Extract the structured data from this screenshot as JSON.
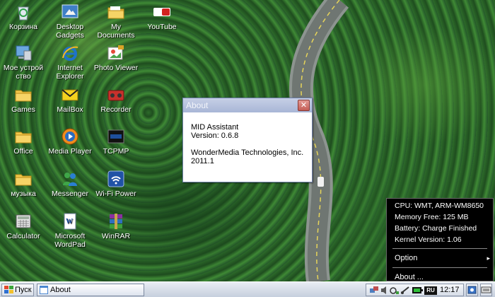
{
  "desktop": {
    "icons": [
      {
        "label": "Корзина",
        "icon": "recycle-bin-icon"
      },
      {
        "label": "Desktop Gadgets",
        "icon": "gadgets-icon"
      },
      {
        "label": "My Documents",
        "icon": "folder-icon"
      },
      {
        "label": "YouTube",
        "icon": "youtube-icon"
      },
      {
        "label": "Мое устрой ство",
        "icon": "my-device-icon"
      },
      {
        "label": "Internet Explorer",
        "icon": "internet-explorer-icon"
      },
      {
        "label": "Photo Viewer",
        "icon": "photo-viewer-icon"
      },
      {
        "label": "Games",
        "icon": "folder-icon"
      },
      {
        "label": "MailBox",
        "icon": "mail-icon"
      },
      {
        "label": "Recorder",
        "icon": "recorder-icon"
      },
      {
        "label": "Office",
        "icon": "folder-icon"
      },
      {
        "label": "Media Player",
        "icon": "media-player-icon"
      },
      {
        "label": "TCPMP",
        "icon": "tcpmp-icon"
      },
      {
        "label": "музыка",
        "icon": "folder-icon"
      },
      {
        "label": "Messenger",
        "icon": "messenger-icon"
      },
      {
        "label": "Wi-Fi Power",
        "icon": "wifi-icon"
      },
      {
        "label": "Calculator",
        "icon": "calculator-icon"
      },
      {
        "label": "Microsoft WordPad",
        "icon": "wordpad-icon"
      },
      {
        "label": "WinRAR",
        "icon": "winrar-icon"
      }
    ]
  },
  "about_dialog": {
    "title": "About",
    "close_symbol": "✕",
    "app_name": "MID Assistant",
    "version": "Version:  0.6.8",
    "company": "WonderMedia Technologies, Inc.",
    "year": "2011.1"
  },
  "info_popup": {
    "cpu": "CPU: WMT, ARM-WM8650",
    "memory": "Memory Free: 125 MB",
    "battery": "Battery: Charge Finished",
    "kernel": "Kernel Version: 1.06",
    "menu": {
      "option_label": "Option",
      "option_arrow": "▸",
      "about_label": "About ..."
    }
  },
  "taskbar": {
    "start_label": "Пуск",
    "active_task_label": "About",
    "language": "RU",
    "clock": "12:17"
  },
  "colors": {
    "dialog_title_bg": "#a8b6d6",
    "close_button": "#c45e56",
    "popup_bg": "#000000",
    "taskbar_bg": "#d6dde8"
  }
}
